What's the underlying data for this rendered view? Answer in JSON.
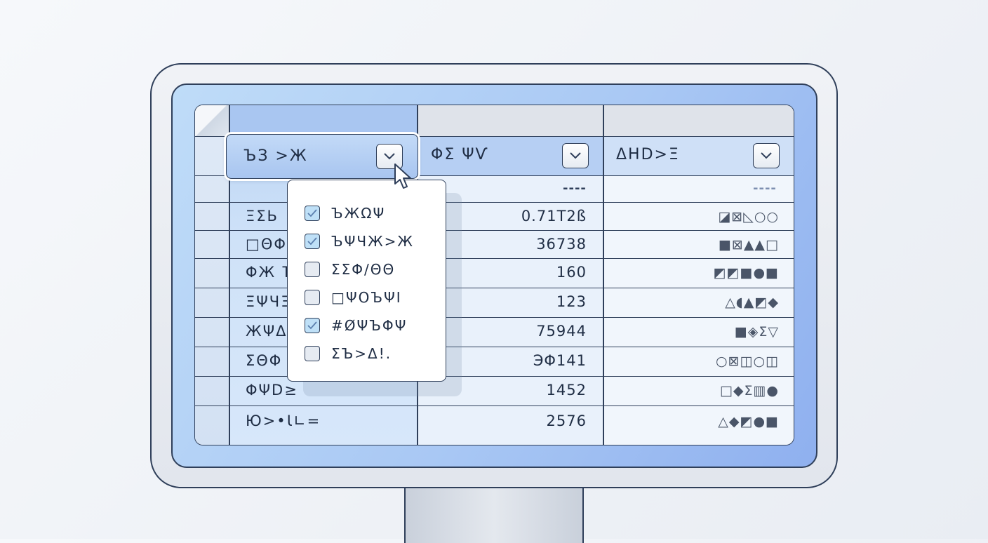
{
  "columns": [
    {
      "header": "ЪЗ >Ж"
    },
    {
      "header": "ΦΣ ΨѴ"
    },
    {
      "header": "ΔΗD>Ξ"
    }
  ],
  "subheader": {
    "col2_marker": "----",
    "col3_marker": "----"
  },
  "rows": [
    {
      "label": "ΞΣЬ",
      "value": "0.71T2ß",
      "shapes": "◪⊠◺○○"
    },
    {
      "label": "□ΘΦ",
      "value": "36738",
      "shapes": "■⊠▲▲□"
    },
    {
      "label": "ΦЖ Ъ",
      "value": "160",
      "shapes": "◩◩■●■"
    },
    {
      "label": "ΞΨЧΞ",
      "value": "123",
      "shapes": "△◖▲◩◆"
    },
    {
      "label": "ЖΨΔ",
      "value": "75944",
      "shapes": "■◈Σ▽"
    },
    {
      "label": "ΣΘΦ",
      "value": "ЭΦ141",
      "shapes": "○⊠◫○◫"
    },
    {
      "label": "ΦΨD≥",
      "value": "1452",
      "shapes": "□◆Σ▥●"
    },
    {
      "label": "Ю>•Ɩ∟=",
      "value": "2576",
      "shapes": "△◆◩●■"
    }
  ],
  "filter_popup": {
    "options": [
      {
        "label": "ЪЖΩΨ",
        "checked": true
      },
      {
        "label": "ЪΨЧЖ>Ж",
        "checked": true
      },
      {
        "label": "ΣΣΦ/ΘΘ",
        "checked": false
      },
      {
        "label": "□ΨΟЪΨΙ",
        "checked": false
      },
      {
        "label": "#ØΨЪΦΨ",
        "checked": true
      },
      {
        "label": "ΣЪ>Δ!.",
        "checked": false
      }
    ]
  },
  "colors": {
    "outline": "#2f3f5a",
    "screen_gradient_start": "#bfdcf8",
    "screen_gradient_end": "#8fb0ef",
    "checkbox_checked": "#bfe0f7"
  },
  "icons": {
    "dropdown": "chevron-down-icon",
    "checkbox_checked": "checkmark-icon",
    "cursor": "mouse-pointer-icon"
  }
}
